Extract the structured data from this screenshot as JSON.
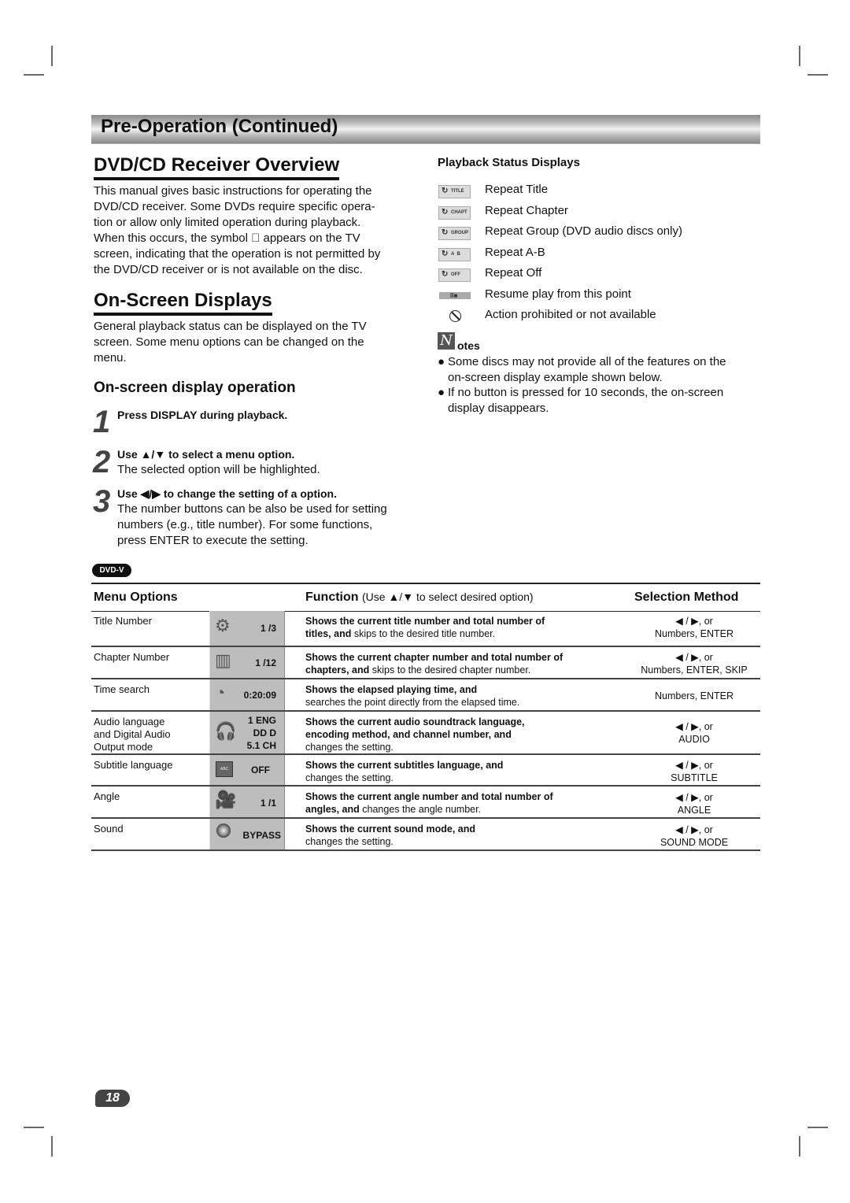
{
  "section_header": "Pre-Operation (Continued)",
  "overview": {
    "title": "DVD/CD Receiver Overview",
    "paragraph_lines": [
      "This manual gives basic instructions for operating the",
      "DVD/CD receiver. Some DVDs require specific opera-",
      "tion or allow only limited operation during playback.",
      "When this occurs, the symbol ⃠ appears on the TV",
      "screen, indicating that the operation is not permitted by",
      "the DVD/CD receiver or is not available on the disc."
    ]
  },
  "onscreen": {
    "title": "On-Screen Displays",
    "paragraph_lines": [
      "General playback status can be displayed on the TV",
      "screen. Some menu options can be changed on the",
      "menu."
    ],
    "operation_title": "On-screen display operation",
    "steps": [
      {
        "num": "1",
        "title": "Press DISPLAY during playback.",
        "lines": []
      },
      {
        "num": "2",
        "title": "Use ▲/▼ to select a menu option.",
        "lines": [
          "The selected option will be highlighted."
        ]
      },
      {
        "num": "3",
        "title": "Use ◀/▶ to change the setting of a option.",
        "lines": [
          "The number buttons can be also be used for setting",
          "numbers (e.g., title number). For some functions,",
          "press ENTER to execute the setting."
        ]
      }
    ]
  },
  "playback_status": {
    "title": "Playback Status Displays",
    "items": [
      {
        "icon": "repeat-icon",
        "icon_label": "TITLE",
        "label": "Repeat Title"
      },
      {
        "icon": "repeat-icon",
        "icon_label": "CHAPT",
        "label": "Repeat Chapter"
      },
      {
        "icon": "repeat-icon",
        "icon_label": "GROUP",
        "label": "Repeat Group (DVD audio discs only)"
      },
      {
        "icon": "repeat-icon",
        "icon_label": "A  B",
        "label": "Repeat A-B"
      },
      {
        "icon": "repeat-icon",
        "icon_label": "OFF",
        "label": "Repeat Off"
      },
      {
        "icon": "resume-icon",
        "icon_label": "II■",
        "label": "Resume play from this point"
      },
      {
        "icon": "prohibited-icon",
        "icon_label": "⃠",
        "label": "Action prohibited or not available"
      }
    ]
  },
  "notes": {
    "icon_letter": "N",
    "title": "otes",
    "items": [
      [
        "Some discs may not provide all of the features on the",
        "on-screen display example shown below."
      ],
      [
        "If no button is pressed for 10 seconds, the on-screen",
        "display disappears."
      ]
    ]
  },
  "disc_badge": "DVD-V",
  "table": {
    "headers": {
      "menu": "Menu Options",
      "function_bold": "Function",
      "function_rest": "(Use ▲/▼ to select desired option)",
      "selection": "Selection Method"
    },
    "rows": [
      {
        "menu": [
          "Title Number"
        ],
        "osd_icon": "film-reel-icon",
        "osd_values": [
          "1 /3"
        ],
        "func_bold": [
          "Shows the current title number and total number of",
          "titles, and"
        ],
        "func_rest": "skips to the desired title number.",
        "selection": [
          "◀ / ▶, or",
          "Numbers, ENTER"
        ]
      },
      {
        "menu": [
          "Chapter Number"
        ],
        "osd_icon": "film-strip-icon",
        "osd_values": [
          "1 /12"
        ],
        "func_bold": [
          "Shows the current chapter number and total number of",
          "chapters, and"
        ],
        "func_rest": "skips to the desired chapter number.",
        "selection": [
          "◀ / ▶, or",
          "Numbers, ENTER, SKIP"
        ]
      },
      {
        "menu": [
          "Time search"
        ],
        "osd_icon": "clock-icon",
        "osd_values": [
          "0:20:09"
        ],
        "func_bold": [
          "Shows the elapsed playing time, and"
        ],
        "func_rest": "searches the point directly from the elapsed time.",
        "selection": [
          "Numbers, ENTER"
        ]
      },
      {
        "menu": [
          "Audio language",
          "and Digital Audio",
          "Output mode"
        ],
        "osd_icon": "headphones-icon",
        "osd_values": [
          "1 ENG",
          "DD D",
          "5.1 CH"
        ],
        "func_bold": [
          "Shows the current audio soundtrack language,",
          "encoding method, and channel number, and"
        ],
        "func_rest": "changes the setting.",
        "selection": [
          "◀ / ▶, or",
          "AUDIO"
        ]
      },
      {
        "menu": [
          "Subtitle language"
        ],
        "osd_icon": "subtitle-icon",
        "osd_values": [
          "OFF"
        ],
        "func_bold": [
          "Shows the current subtitles language, and"
        ],
        "func_rest": "changes the setting.",
        "selection": [
          "◀ / ▶, or",
          "SUBTITLE"
        ]
      },
      {
        "menu": [
          "Angle"
        ],
        "osd_icon": "camera-icon",
        "osd_values": [
          "1 /1"
        ],
        "func_bold": [
          "Shows the current angle number and total number of",
          "angles, and"
        ],
        "func_rest": "changes the angle number.",
        "selection": [
          "◀ / ▶, or",
          "ANGLE"
        ]
      },
      {
        "menu": [
          "Sound"
        ],
        "osd_icon": "speaker-icon",
        "osd_values": [
          "BYPASS"
        ],
        "func_bold": [
          "Shows the current sound mode, and"
        ],
        "func_rest": "changes the setting.",
        "selection": [
          "◀ / ▶, or",
          "SOUND MODE"
        ]
      }
    ]
  },
  "page_number": "18"
}
